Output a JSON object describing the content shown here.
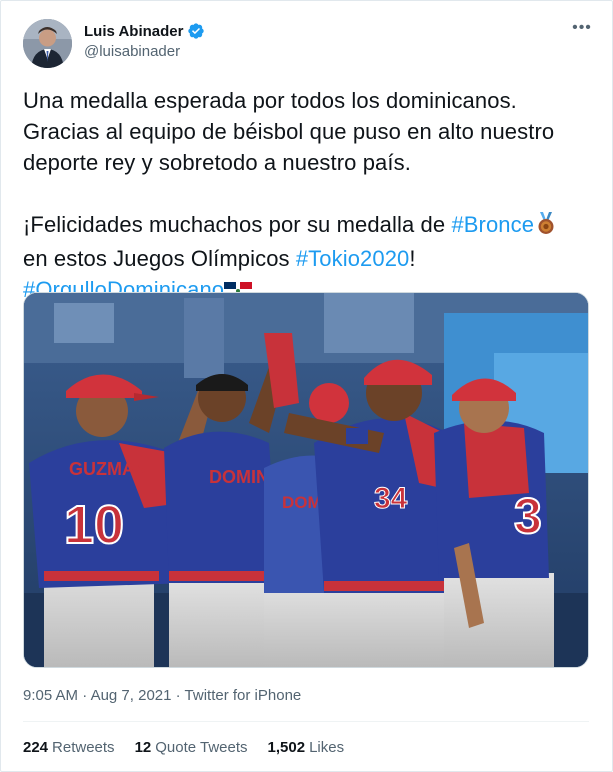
{
  "author": {
    "display_name": "Luis Abinader",
    "handle": "@luisabinader",
    "verified_color": "#1d9bf0"
  },
  "tweet": {
    "line1": "Una medalla esperada por todos los dominicanos.",
    "line2": "Gracias al equipo de béisbol que puso en alto nuestro",
    "line3": "deporte rey y sobretodo a nuestro país.",
    "line4_a": "¡Felicidades muchachos por su medalla de ",
    "hashtag_bronce": "#Bronce",
    "line5_a": "en estos Juegos Olímpicos ",
    "hashtag_tokio": "#Tokio2020",
    "line5_b": "!",
    "hashtag_orgullo": "#OrgulloDominicano",
    "emoji_medal": "bronze-medal-icon",
    "emoji_flag": "dominican-flag-icon"
  },
  "meta": {
    "time": "9:05 AM",
    "sep1": " · ",
    "date": "Aug 7, 2021",
    "sep2": " · ",
    "source": "Twitter for iPhone"
  },
  "stats": {
    "retweets_count": "224",
    "retweets_label": "Retweets",
    "quotes_count": "12",
    "quotes_label": "Quote Tweets",
    "likes_count": "1,502",
    "likes_label": "Likes"
  },
  "media": {
    "jersey_numbers": [
      "10",
      "34",
      "3"
    ],
    "jersey_names": [
      "GUZMAN",
      "DOMIN",
      "DOMIN"
    ]
  },
  "colors": {
    "link": "#1d9bf0",
    "jersey_blue": "#2b3f9c",
    "jersey_red": "#c8323a",
    "text_secondary": "#536471"
  }
}
